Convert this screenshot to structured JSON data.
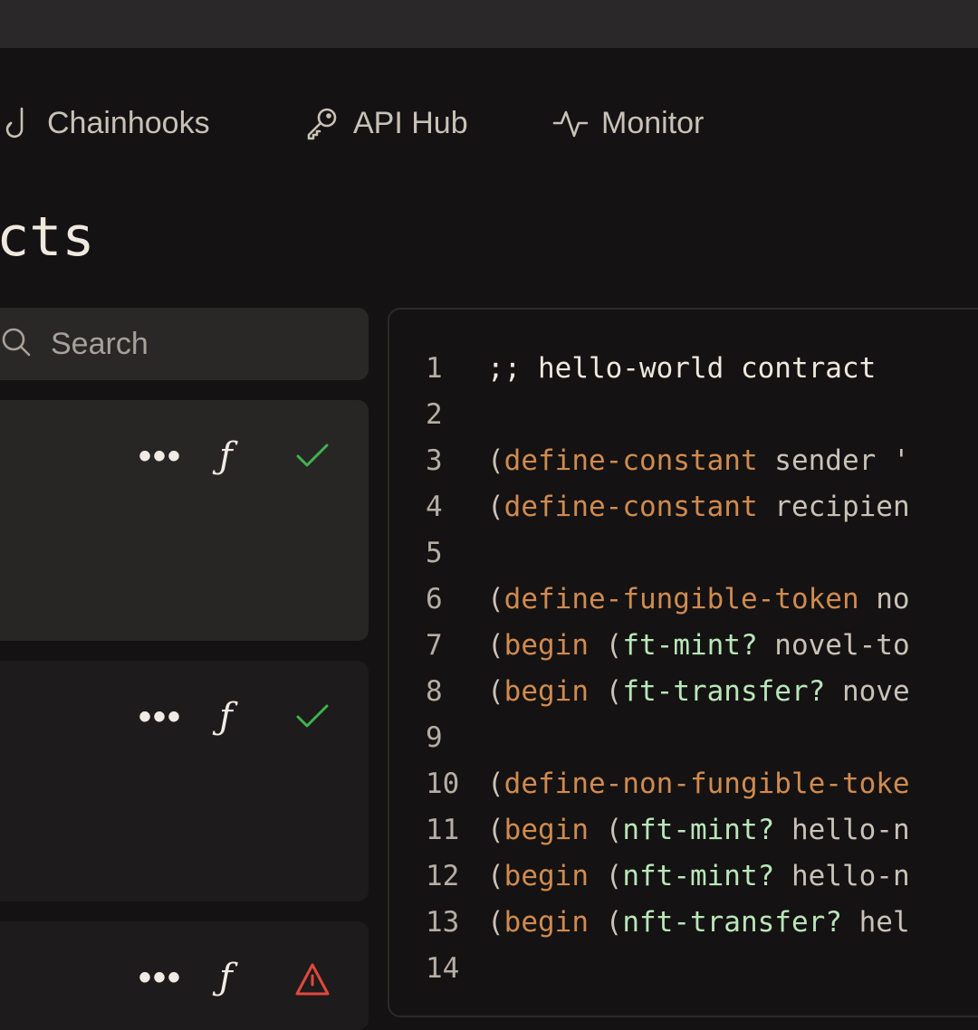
{
  "nav": {
    "items": [
      {
        "label": "Chainhooks",
        "icon": "hook-icon"
      },
      {
        "label": "API Hub",
        "icon": "key-icon"
      },
      {
        "label": "Monitor",
        "icon": "activity-icon"
      }
    ]
  },
  "page": {
    "title": "acts"
  },
  "search": {
    "placeholder": "Search"
  },
  "cards": [
    {
      "menu": "•••",
      "fn": "ƒ",
      "status": "success"
    },
    {
      "menu": "•••",
      "fn": "ƒ",
      "status": "success"
    },
    {
      "menu": "•••",
      "fn": "ƒ",
      "status": "warning"
    }
  ],
  "colors": {
    "success": "#3fb24e",
    "warning": "#e0483e",
    "keyword": "#d08b4f",
    "function": "#b9e6b8"
  },
  "code": {
    "lines": [
      {
        "n": "1",
        "parts": [
          {
            "t": ";; hello-world contract",
            "c": "cm"
          }
        ]
      },
      {
        "n": "2",
        "parts": []
      },
      {
        "n": "3",
        "parts": [
          {
            "t": "(",
            "c": "pn"
          },
          {
            "t": "define-constant",
            "c": "kw"
          },
          {
            "t": " sender '",
            "c": "pn"
          }
        ]
      },
      {
        "n": "4",
        "parts": [
          {
            "t": "(",
            "c": "pn"
          },
          {
            "t": "define-constant",
            "c": "kw"
          },
          {
            "t": " recipien",
            "c": "pn"
          }
        ]
      },
      {
        "n": "5",
        "parts": []
      },
      {
        "n": "6",
        "parts": [
          {
            "t": "(",
            "c": "pn"
          },
          {
            "t": "define-fungible-token",
            "c": "kw"
          },
          {
            "t": " no",
            "c": "pn"
          }
        ]
      },
      {
        "n": "7",
        "parts": [
          {
            "t": "(",
            "c": "pn"
          },
          {
            "t": "begin",
            "c": "kw"
          },
          {
            "t": " (",
            "c": "pn"
          },
          {
            "t": "ft-mint?",
            "c": "fnc"
          },
          {
            "t": " novel-to",
            "c": "pn"
          }
        ]
      },
      {
        "n": "8",
        "parts": [
          {
            "t": "(",
            "c": "pn"
          },
          {
            "t": "begin",
            "c": "kw"
          },
          {
            "t": " (",
            "c": "pn"
          },
          {
            "t": "ft-transfer?",
            "c": "fnc"
          },
          {
            "t": " nove",
            "c": "pn"
          }
        ]
      },
      {
        "n": "9",
        "parts": []
      },
      {
        "n": "10",
        "parts": [
          {
            "t": "(",
            "c": "pn"
          },
          {
            "t": "define-non-fungible-toke",
            "c": "kw"
          }
        ]
      },
      {
        "n": "11",
        "parts": [
          {
            "t": "(",
            "c": "pn"
          },
          {
            "t": "begin",
            "c": "kw"
          },
          {
            "t": " (",
            "c": "pn"
          },
          {
            "t": "nft-mint?",
            "c": "fnc"
          },
          {
            "t": " hello-n",
            "c": "pn"
          }
        ]
      },
      {
        "n": "12",
        "parts": [
          {
            "t": "(",
            "c": "pn"
          },
          {
            "t": "begin",
            "c": "kw"
          },
          {
            "t": " (",
            "c": "pn"
          },
          {
            "t": "nft-mint?",
            "c": "fnc"
          },
          {
            "t": " hello-n",
            "c": "pn"
          }
        ]
      },
      {
        "n": "13",
        "parts": [
          {
            "t": "(",
            "c": "pn"
          },
          {
            "t": "begin",
            "c": "kw"
          },
          {
            "t": " (",
            "c": "pn"
          },
          {
            "t": "nft-transfer?",
            "c": "fnc"
          },
          {
            "t": " hel",
            "c": "pn"
          }
        ]
      },
      {
        "n": "14",
        "parts": []
      }
    ]
  }
}
